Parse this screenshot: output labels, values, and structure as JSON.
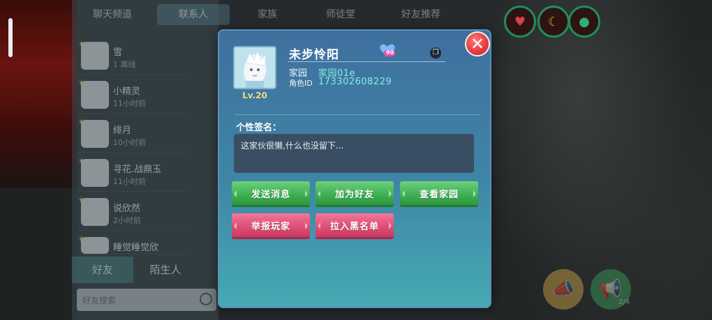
{
  "background": {
    "top_tabs": [
      {
        "label": "聊天频道"
      },
      {
        "label": "联系人",
        "active": true
      },
      {
        "label": "家族"
      },
      {
        "label": "师徒堂"
      },
      {
        "label": "好友推荐"
      }
    ],
    "contacts": [
      {
        "name": "雪",
        "status": "1 离线"
      },
      {
        "name": "小精灵",
        "status": "11小时前"
      },
      {
        "name": "绯月",
        "status": "10小时前"
      },
      {
        "name": "寻花.战鼎玉",
        "status": "11小时前"
      },
      {
        "name": "说欣然",
        "status": "2小时前"
      },
      {
        "name": "睡觉睡觉欣",
        "status": ""
      }
    ],
    "bottom_tabs": [
      {
        "label": "好友",
        "active": true
      },
      {
        "label": "陌生人"
      }
    ],
    "friend_search_placeholder": "好友搜索",
    "hud_icons": [
      "heart-icon",
      "moon-icon",
      "drop-icon"
    ],
    "action_icons": [
      "megaphone-icon",
      "broadcast-icon"
    ],
    "action_badge": "2/4"
  },
  "dialog": {
    "player_name": "未步怜阳",
    "level": "Lv.20",
    "home_label": "家园",
    "home_value": "家园01e",
    "role_id_label": "角色ID",
    "role_id_value": "173302608229",
    "badge_text": "90",
    "signature_label": "个性签名：",
    "signature_text": "这家伙很懒,什么也没留下...",
    "close_symbol": "✕",
    "copy_symbol": "❐",
    "buttons": {
      "send_message": "发送消息",
      "add_friend": "加为好友",
      "view_home": "查看家园",
      "report_player": "举报玩家",
      "blacklist": "拉入黑名单"
    }
  },
  "colors": {
    "green_button": "#3fb054",
    "pink_button": "#de4f77",
    "accent_text": "#7ff0e6",
    "level_text": "#f3d97a"
  }
}
